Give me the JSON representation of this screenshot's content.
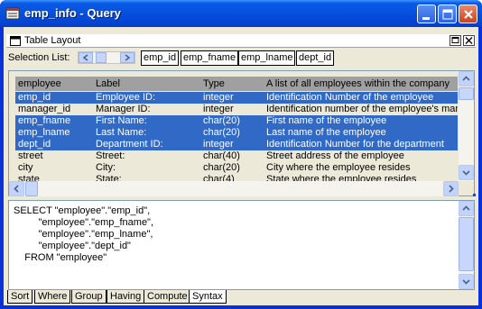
{
  "window": {
    "title": "emp_info - Query",
    "accent": "#0550dc"
  },
  "icons": {
    "app": "query-app-icon",
    "minimize": "minimize-icon",
    "maximize": "maximize-icon",
    "close": "close-icon"
  },
  "table_layout": {
    "title": "Table Layout"
  },
  "selection": {
    "label": "Selection List:",
    "columns": [
      "emp_id",
      "emp_fname",
      "emp_lname",
      "dept_id"
    ]
  },
  "grid": {
    "headers": [
      "employee",
      "Label",
      "Type",
      "A list of all employees within the company"
    ],
    "rows": [
      {
        "name": "emp_id",
        "label": "Employee ID:",
        "type": "integer",
        "desc": "Identification Number of the employee",
        "selected": true
      },
      {
        "name": "manager_id",
        "label": "Manager ID:",
        "type": "integer",
        "desc": "Identification number of the employee's manager",
        "selected": false
      },
      {
        "name": "emp_fname",
        "label": "First Name:",
        "type": "char(20)",
        "desc": "First name of the employee",
        "selected": true
      },
      {
        "name": "emp_lname",
        "label": "Last Name:",
        "type": "char(20)",
        "desc": "Last name of the employee",
        "selected": true
      },
      {
        "name": "dept_id",
        "label": "Department ID:",
        "type": "integer",
        "desc": "Identification Number for the department",
        "selected": true
      },
      {
        "name": "street",
        "label": "Street:",
        "type": "char(40)",
        "desc": "Street address of the employee",
        "selected": false
      },
      {
        "name": "city",
        "label": "City:",
        "type": "char(20)",
        "desc": "City where the employee resides",
        "selected": false
      },
      {
        "name": "state",
        "label": "State:",
        "type": "char(4)",
        "desc": "State where the employee resides",
        "selected": false
      }
    ]
  },
  "sql": {
    "lines": [
      "SELECT \"employee\".\"emp_id\",",
      "         \"employee\".\"emp_fname\",",
      "         \"employee\".\"emp_lname\",",
      "         \"employee\".\"dept_id\"",
      "    FROM \"employee\""
    ]
  },
  "tabs": [
    {
      "label": "Sort",
      "active": false
    },
    {
      "label": "Where",
      "active": false
    },
    {
      "label": "Group",
      "active": false
    },
    {
      "label": "Having",
      "active": false
    },
    {
      "label": "Compute",
      "active": false
    },
    {
      "label": "Syntax",
      "active": true
    }
  ]
}
